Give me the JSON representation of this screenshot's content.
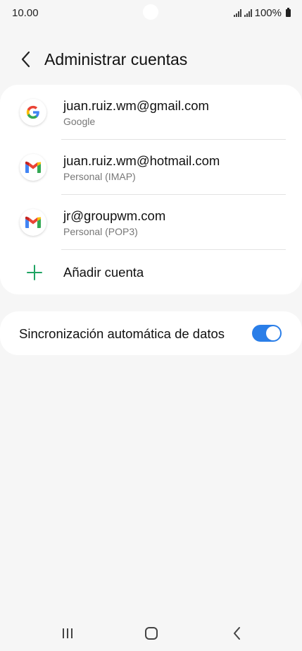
{
  "status_bar": {
    "time": "10.00",
    "battery": "100%"
  },
  "header": {
    "title": "Administrar cuentas",
    "back_icon": "chevron-left-icon"
  },
  "accounts": [
    {
      "email": "juan.ruiz.wm@gmail.com",
      "type": "Google",
      "icon": "google-icon"
    },
    {
      "email": "juan.ruiz.wm@hotmail.com",
      "type": "Personal (IMAP)",
      "icon": "gmail-icon"
    },
    {
      "email": "jr@groupwm.com",
      "type": "Personal (POP3)",
      "icon": "gmail-icon"
    }
  ],
  "add_account": {
    "label": "Añadir cuenta",
    "icon": "plus-icon",
    "color": "#1fa463"
  },
  "sync": {
    "label": "Sincronización automática de datos",
    "enabled": true,
    "accent": "#2a7ee8"
  },
  "nav_bar": {
    "recents_icon": "recents-icon",
    "home_icon": "home-icon",
    "back_icon": "back-icon"
  }
}
